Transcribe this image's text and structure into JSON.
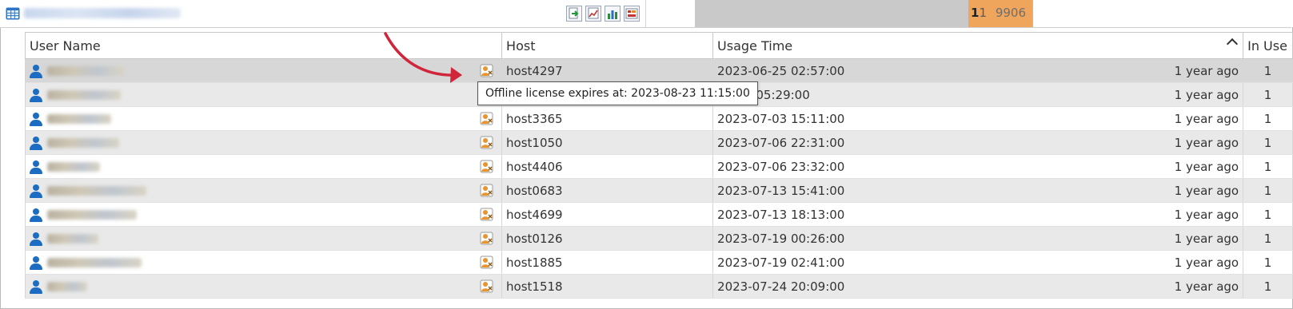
{
  "colors": {
    "accent": "#1b6cc2",
    "gauge_fill": "#f0a55c",
    "arrow": "#d0253a"
  },
  "toolbar": {
    "icons": [
      "export-icon",
      "line-chart-icon",
      "bar-chart-icon",
      "report-icon"
    ]
  },
  "license_gauge": {
    "total": "9906",
    "in_use": "11",
    "in_use_first": "1",
    "in_use_rest": "1"
  },
  "table": {
    "headers": {
      "user": "User Name",
      "host": "Host",
      "usage": "Usage Time",
      "inuse": "In Use"
    },
    "rows": [
      {
        "host": "host4297",
        "time": "2023-06-25 02:57:00",
        "ago": "1 year ago",
        "inuse": "1"
      },
      {
        "host": "",
        "time": "06-30 05:29:00",
        "ago": "1 year ago",
        "inuse": "1"
      },
      {
        "host": "host3365",
        "time": "2023-07-03 15:11:00",
        "ago": "1 year ago",
        "inuse": "1"
      },
      {
        "host": "host1050",
        "time": "2023-07-06 22:31:00",
        "ago": "1 year ago",
        "inuse": "1"
      },
      {
        "host": "host4406",
        "time": "2023-07-06 23:32:00",
        "ago": "1 year ago",
        "inuse": "1"
      },
      {
        "host": "host0683",
        "time": "2023-07-13 15:41:00",
        "ago": "1 year ago",
        "inuse": "1"
      },
      {
        "host": "host4699",
        "time": "2023-07-13 18:13:00",
        "ago": "1 year ago",
        "inuse": "1"
      },
      {
        "host": "host0126",
        "time": "2023-07-19 00:26:00",
        "ago": "1 year ago",
        "inuse": "1"
      },
      {
        "host": "host1885",
        "time": "2023-07-19 02:41:00",
        "ago": "1 year ago",
        "inuse": "1"
      },
      {
        "host": "host1518",
        "time": "2023-07-24 20:09:00",
        "ago": "1 year ago",
        "inuse": "1"
      }
    ]
  },
  "tooltip": {
    "text": "Offline license expires at: 2023-08-23 11:15:00"
  }
}
